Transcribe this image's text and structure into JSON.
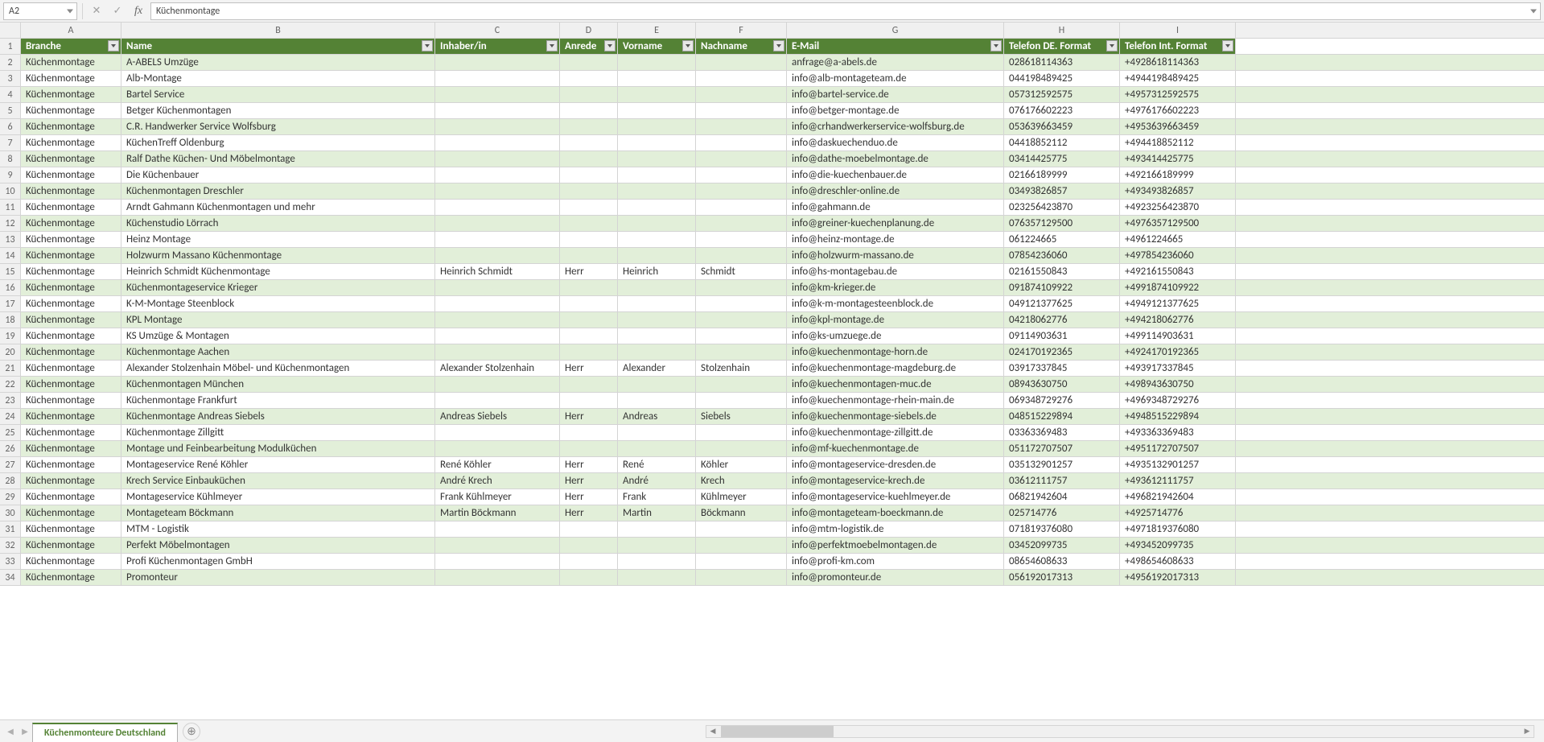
{
  "formulaBar": {
    "nameBox": "A2",
    "formula": "Küchenmontage"
  },
  "columns": [
    "A",
    "B",
    "C",
    "D",
    "E",
    "F",
    "G",
    "H",
    "I"
  ],
  "headers": {
    "A": "Branche",
    "B": "Name",
    "C": "Inhaber/in",
    "D": "Anrede",
    "E": "Vorname",
    "F": "Nachname",
    "G": "E-Mail",
    "H": "Telefon DE. Format",
    "I": "Telefon Int. Format"
  },
  "rows": [
    {
      "n": 2,
      "A": "Küchenmontage",
      "B": "A-ABELS Umzüge",
      "C": "",
      "D": "",
      "E": "",
      "F": "",
      "G": "anfrage@a-abels.de",
      "H": "028618114363",
      "I": "+4928618114363"
    },
    {
      "n": 3,
      "A": "Küchenmontage",
      "B": "Alb-Montage",
      "C": "",
      "D": "",
      "E": "",
      "F": "",
      "G": "info@alb-montageteam.de",
      "H": "044198489425",
      "I": "+4944198489425"
    },
    {
      "n": 4,
      "A": "Küchenmontage",
      "B": "Bartel Service",
      "C": "",
      "D": "",
      "E": "",
      "F": "",
      "G": "info@bartel-service.de",
      "H": "057312592575",
      "I": "+4957312592575"
    },
    {
      "n": 5,
      "A": "Küchenmontage",
      "B": "Betger Küchenmontagen",
      "C": "",
      "D": "",
      "E": "",
      "F": "",
      "G": "info@betger-montage.de",
      "H": "076176602223",
      "I": "+4976176602223"
    },
    {
      "n": 6,
      "A": "Küchenmontage",
      "B": "C.R. Handwerker Service Wolfsburg",
      "C": "",
      "D": "",
      "E": "",
      "F": "",
      "G": "info@crhandwerkerservice-wolfsburg.de",
      "H": "053639663459",
      "I": "+4953639663459"
    },
    {
      "n": 7,
      "A": "Küchenmontage",
      "B": "KüchenTreff Oldenburg",
      "C": "",
      "D": "",
      "E": "",
      "F": "",
      "G": "info@daskuechenduo.de",
      "H": "04418852112",
      "I": "+494418852112"
    },
    {
      "n": 8,
      "A": "Küchenmontage",
      "B": "Ralf Dathe Küchen- Und Möbelmontage",
      "C": "",
      "D": "",
      "E": "",
      "F": "",
      "G": "info@dathe-moebelmontage.de",
      "H": "03414425775",
      "I": "+493414425775"
    },
    {
      "n": 9,
      "A": "Küchenmontage",
      "B": "Die Küchenbauer",
      "C": "",
      "D": "",
      "E": "",
      "F": "",
      "G": "info@die-kuechenbauer.de",
      "H": "02166189999",
      "I": "+492166189999"
    },
    {
      "n": 10,
      "A": "Küchenmontage",
      "B": "Küchenmontagen Dreschler",
      "C": "",
      "D": "",
      "E": "",
      "F": "",
      "G": "info@dreschler-online.de",
      "H": "03493826857",
      "I": "+493493826857"
    },
    {
      "n": 11,
      "A": "Küchenmontage",
      "B": "Arndt Gahmann Küchenmontagen und mehr",
      "C": "",
      "D": "",
      "E": "",
      "F": "",
      "G": "info@gahmann.de",
      "H": "023256423870",
      "I": "+4923256423870"
    },
    {
      "n": 12,
      "A": "Küchenmontage",
      "B": "Küchenstudio Lörrach",
      "C": "",
      "D": "",
      "E": "",
      "F": "",
      "G": "info@greiner-kuechenplanung.de",
      "H": "076357129500",
      "I": "+4976357129500"
    },
    {
      "n": 13,
      "A": "Küchenmontage",
      "B": "Heinz Montage",
      "C": "",
      "D": "",
      "E": "",
      "F": "",
      "G": "info@heinz-montage.de",
      "H": "061224665",
      "I": "+4961224665"
    },
    {
      "n": 14,
      "A": "Küchenmontage",
      "B": "Holzwurm Massano Küchenmontage",
      "C": "",
      "D": "",
      "E": "",
      "F": "",
      "G": "info@holzwurm-massano.de",
      "H": "07854236060",
      "I": "+497854236060"
    },
    {
      "n": 15,
      "A": "Küchenmontage",
      "B": "Heinrich Schmidt Küchenmontage",
      "C": "Heinrich Schmidt",
      "D": "Herr",
      "E": "Heinrich",
      "F": "Schmidt",
      "G": "info@hs-montagebau.de",
      "H": "02161550843",
      "I": "+492161550843"
    },
    {
      "n": 16,
      "A": "Küchenmontage",
      "B": "Küchenmontageservice Krieger",
      "C": "",
      "D": "",
      "E": "",
      "F": "",
      "G": "info@km-krieger.de",
      "H": "091874109922",
      "I": "+4991874109922"
    },
    {
      "n": 17,
      "A": "Küchenmontage",
      "B": "K-M-Montage Steenblock",
      "C": "",
      "D": "",
      "E": "",
      "F": "",
      "G": "info@k-m-montagesteenblock.de",
      "H": "049121377625",
      "I": "+4949121377625"
    },
    {
      "n": 18,
      "A": "Küchenmontage",
      "B": "KPL Montage",
      "C": "",
      "D": "",
      "E": "",
      "F": "",
      "G": "info@kpl-montage.de",
      "H": "04218062776",
      "I": "+494218062776"
    },
    {
      "n": 19,
      "A": "Küchenmontage",
      "B": "KS Umzüge & Montagen",
      "C": "",
      "D": "",
      "E": "",
      "F": "",
      "G": "info@ks-umzuege.de",
      "H": "09114903631",
      "I": "+499114903631"
    },
    {
      "n": 20,
      "A": "Küchenmontage",
      "B": "Küchenmontage Aachen",
      "C": "",
      "D": "",
      "E": "",
      "F": "",
      "G": "info@kuechenmontage-horn.de",
      "H": "024170192365",
      "I": "+4924170192365"
    },
    {
      "n": 21,
      "A": "Küchenmontage",
      "B": "Alexander Stolzenhain Möbel- und Küchenmontagen",
      "C": "Alexander Stolzenhain",
      "D": "Herr",
      "E": "Alexander",
      "F": "Stolzenhain",
      "G": "info@kuechenmontage-magdeburg.de",
      "H": "03917337845",
      "I": "+493917337845"
    },
    {
      "n": 22,
      "A": "Küchenmontage",
      "B": "Küchenmontagen München",
      "C": "",
      "D": "",
      "E": "",
      "F": "",
      "G": "info@kuechenmontagen-muc.de",
      "H": "08943630750",
      "I": "+498943630750"
    },
    {
      "n": 23,
      "A": "Küchenmontage",
      "B": "Küchenmontage Frankfurt",
      "C": "",
      "D": "",
      "E": "",
      "F": "",
      "G": "info@kuechenmontage-rhein-main.de",
      "H": "069348729276",
      "I": "+4969348729276"
    },
    {
      "n": 24,
      "A": "Küchenmontage",
      "B": "Küchenmontage Andreas Siebels",
      "C": "Andreas Siebels",
      "D": "Herr",
      "E": "Andreas",
      "F": "Siebels",
      "G": "info@kuechenmontage-siebels.de",
      "H": "048515229894",
      "I": "+4948515229894"
    },
    {
      "n": 25,
      "A": "Küchenmontage",
      "B": "Küchenmontage Zillgitt",
      "C": "",
      "D": "",
      "E": "",
      "F": "",
      "G": "info@kuechenmontage-zillgitt.de",
      "H": "03363369483",
      "I": "+493363369483"
    },
    {
      "n": 26,
      "A": "Küchenmontage",
      "B": "Montage und Feinbearbeitung Modulküchen",
      "C": "",
      "D": "",
      "E": "",
      "F": "",
      "G": "info@mf-kuechenmontage.de",
      "H": "051172707507",
      "I": "+4951172707507"
    },
    {
      "n": 27,
      "A": "Küchenmontage",
      "B": "Montageservice René Köhler",
      "C": "René Köhler",
      "D": "Herr",
      "E": "René",
      "F": "Köhler",
      "G": "info@montageservice-dresden.de",
      "H": "035132901257",
      "I": "+4935132901257"
    },
    {
      "n": 28,
      "A": "Küchenmontage",
      "B": "Krech Service Einbauküchen",
      "C": "André Krech",
      "D": "Herr",
      "E": "André",
      "F": "Krech",
      "G": "info@montageservice-krech.de",
      "H": "03612111757",
      "I": "+493612111757"
    },
    {
      "n": 29,
      "A": "Küchenmontage",
      "B": "Montageservice Kühlmeyer",
      "C": "Frank Kühlmeyer",
      "D": "Herr",
      "E": "Frank",
      "F": "Kühlmeyer",
      "G": "info@montageservice-kuehlmeyer.de",
      "H": "06821942604",
      "I": "+496821942604"
    },
    {
      "n": 30,
      "A": "Küchenmontage",
      "B": "Montageteam Böckmann",
      "C": "Martin Böckmann",
      "D": "Herr",
      "E": "Martin",
      "F": "Böckmann",
      "G": "info@montageteam-boeckmann.de",
      "H": "025714776",
      "I": "+4925714776"
    },
    {
      "n": 31,
      "A": "Küchenmontage",
      "B": "MTM - Logistik",
      "C": "",
      "D": "",
      "E": "",
      "F": "",
      "G": "info@mtm-logistik.de",
      "H": "071819376080",
      "I": "+4971819376080"
    },
    {
      "n": 32,
      "A": "Küchenmontage",
      "B": "Perfekt Möbelmontagen",
      "C": "",
      "D": "",
      "E": "",
      "F": "",
      "G": "info@perfektmoebelmontagen.de",
      "H": "03452099735",
      "I": "+493452099735"
    },
    {
      "n": 33,
      "A": "Küchenmontage",
      "B": "Profi Küchenmontagen GmbH",
      "C": "",
      "D": "",
      "E": "",
      "F": "",
      "G": "info@profi-km.com",
      "H": "08654608633",
      "I": "+498654608633"
    },
    {
      "n": 34,
      "A": "Küchenmontage",
      "B": "Promonteur",
      "C": "",
      "D": "",
      "E": "",
      "F": "",
      "G": "info@promonteur.de",
      "H": "056192017313",
      "I": "+4956192017313"
    }
  ],
  "sheetTab": "Küchenmonteure Deutschland"
}
